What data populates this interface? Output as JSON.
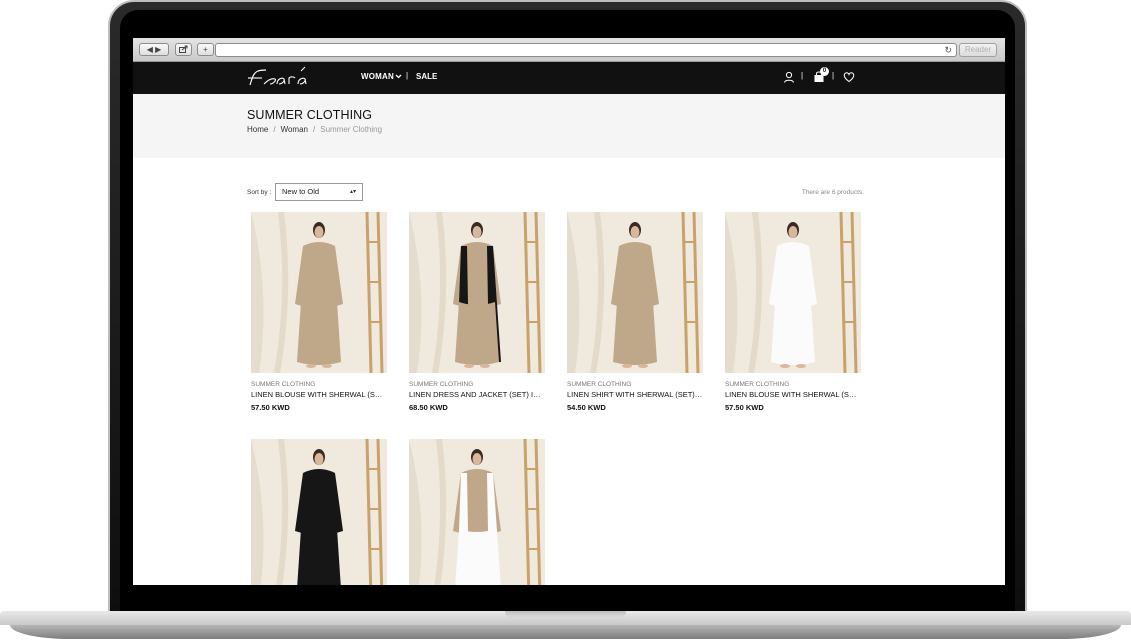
{
  "browser": {
    "back_icon": "back-arrow-icon",
    "forward_icon": "forward-arrow-icon",
    "share_icon": "share-icon",
    "new_tab_icon": "plus-icon",
    "reload_icon": "reload-icon",
    "reader_label": "Reader"
  },
  "header": {
    "logo_text": "Fsara",
    "nav": {
      "woman_label": "WOMAN",
      "sale_label": "SALE",
      "separator": "|"
    },
    "cart_count": "0",
    "icons": [
      "user-icon",
      "cart-icon",
      "heart-icon"
    ]
  },
  "page": {
    "title": "SUMMER CLOTHING",
    "breadcrumb": [
      "Home",
      "Woman",
      "Summer Clothing"
    ],
    "breadcrumb_separator": "/"
  },
  "toolbar": {
    "sort_label": "Sort by :",
    "sort_value": "New to Old",
    "product_count_text": "There are 6 products."
  },
  "products": [
    {
      "category": "SUMMER CLOTHING",
      "name": "LINEN BLOUSE WITH SHERWAL (SET) IN BEIGE",
      "price": "57.50 KWD",
      "palette": "beige"
    },
    {
      "category": "SUMMER CLOTHING",
      "name": "LINEN DRESS AND JACKET (SET) IN BLACK",
      "price": "68.50 KWD",
      "palette": "beige-black"
    },
    {
      "category": "SUMMER CLOTHING",
      "name": "LINEN SHIRT WITH SHERWAL (SET) IN BEIGE",
      "price": "54.50 KWD",
      "palette": "beige"
    },
    {
      "category": "SUMMER CLOTHING",
      "name": "LINEN BLOUSE WITH SHERWAL (SET) IN WHITE",
      "price": "57.50 KWD",
      "palette": "white"
    },
    {
      "category": "",
      "name": "",
      "price": "",
      "palette": "black"
    },
    {
      "category": "",
      "name": "",
      "price": "",
      "palette": "beige-white"
    }
  ],
  "colors": {
    "header_bg": "#111111",
    "title_band_bg": "#f5f5f5",
    "backdrop": "#efe9de",
    "ladder": "#c9a16b",
    "beige": "#bfa88a",
    "black": "#161616",
    "white": "#fbfbfb"
  }
}
